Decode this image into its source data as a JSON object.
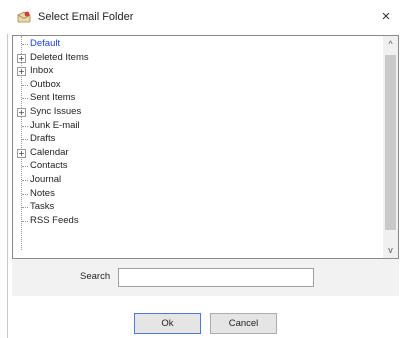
{
  "window": {
    "title": "Select Email Folder",
    "close_label": "×"
  },
  "folders": [
    {
      "label": "Default",
      "expandable": false,
      "selected": true
    },
    {
      "label": "Deleted Items",
      "expandable": true,
      "selected": false
    },
    {
      "label": "Inbox",
      "expandable": true,
      "selected": false
    },
    {
      "label": "Outbox",
      "expandable": false,
      "selected": false
    },
    {
      "label": "Sent Items",
      "expandable": false,
      "selected": false
    },
    {
      "label": "Sync Issues",
      "expandable": true,
      "selected": false
    },
    {
      "label": "Junk E-mail",
      "expandable": false,
      "selected": false
    },
    {
      "label": "Drafts",
      "expandable": false,
      "selected": false
    },
    {
      "label": "Calendar",
      "expandable": true,
      "selected": false
    },
    {
      "label": "Contacts",
      "expandable": false,
      "selected": false
    },
    {
      "label": "Journal",
      "expandable": false,
      "selected": false
    },
    {
      "label": "Notes",
      "expandable": false,
      "selected": false
    },
    {
      "label": "Tasks",
      "expandable": false,
      "selected": false
    },
    {
      "label": "RSS Feeds",
      "expandable": false,
      "selected": false
    }
  ],
  "tree": {
    "expand_glyph": "+",
    "scroll_up_glyph": "^",
    "scroll_down_glyph": "v"
  },
  "search": {
    "label": "Search",
    "value": ""
  },
  "buttons": {
    "ok": "Ok",
    "cancel": "Cancel"
  },
  "colors": {
    "selected_text": "#1a3fd6",
    "default_button_border": "#4b7bd6"
  },
  "icons": {
    "title": "mail-folder-icon"
  }
}
